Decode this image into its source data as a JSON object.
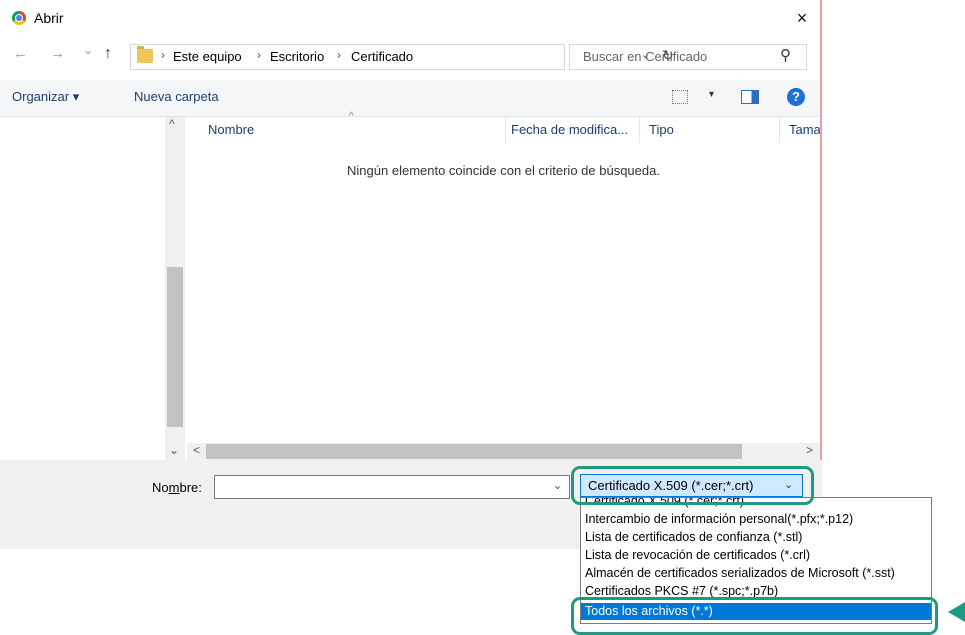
{
  "window": {
    "title": "Abrir",
    "close_glyph": "×"
  },
  "nav": {
    "back_glyph": "←",
    "forward_glyph": "→",
    "recent_glyph": "⌄",
    "up_glyph": "↑"
  },
  "address": {
    "crumbs": [
      "Este equipo",
      "Escritorio",
      "Certificado"
    ],
    "separator": "›",
    "dropdown_glyph": "⌄",
    "refresh_glyph": "↻"
  },
  "search": {
    "placeholder": "Buscar en Certificado",
    "icon_glyph": "⚲"
  },
  "toolbar": {
    "organize_label": "Organizar ▾",
    "new_folder_label": "Nueva carpeta",
    "view_dd_glyph": "▾",
    "help_glyph": "?"
  },
  "filelist": {
    "columns": [
      "Nombre",
      "Fecha de modifica...",
      "Tipo",
      "Tama"
    ],
    "sort_glyph": "^",
    "empty_message": "Ningún elemento coincide con el criterio de búsqueda."
  },
  "scroll": {
    "up_glyph": "^",
    "down_glyph": "⌄",
    "left_glyph": "<",
    "right_glyph": ">"
  },
  "filename": {
    "label_prefix": "No",
    "label_accel": "m",
    "label_suffix": "bre:",
    "value": "",
    "dropdown_glyph": "⌄"
  },
  "filetype": {
    "selected": "Certificado X.509 (*.cer;*.crt)",
    "dropdown_glyph": "⌄",
    "options": [
      "Certificado X.509 (*.cer;*.crt)",
      "Intercambio de información personal(*.pfx;*.p12)",
      "Lista de certificados de confianza (*.stl)",
      "Lista de revocación de certificados (*.crl)",
      "Almacén de certificados serializados de Microsoft (*.sst)",
      "Certificados PKCS #7 (*.spc;*.p7b)",
      "Todos los archivos (*.*)"
    ],
    "highlighted_option": "Todos los archivos (*.*)"
  },
  "colors": {
    "accent": "#0078d7",
    "highlight_ring": "#1a9b82",
    "selected_bg": "#cde8ff"
  }
}
